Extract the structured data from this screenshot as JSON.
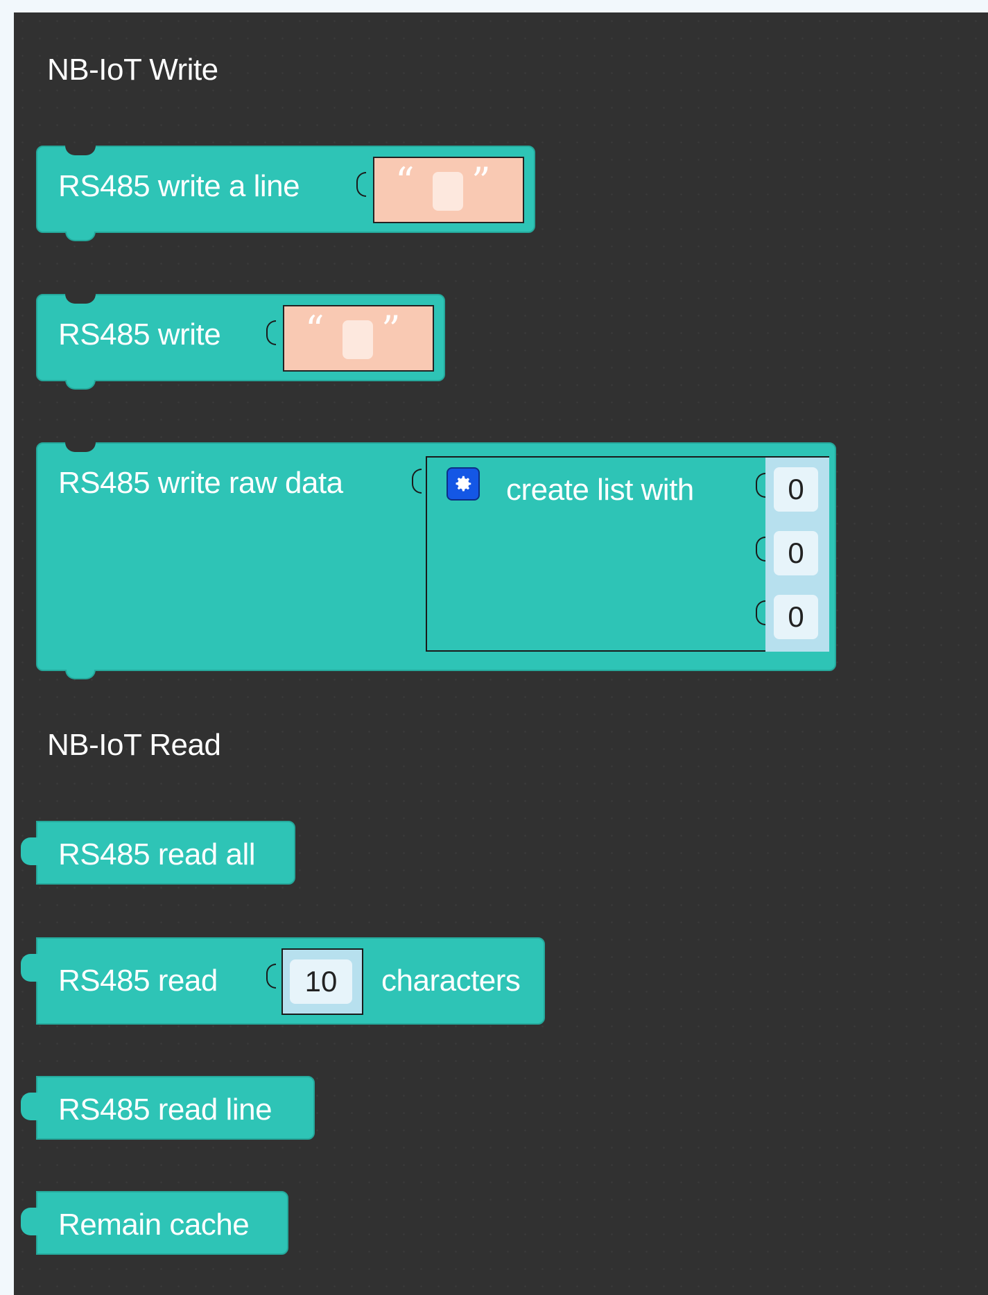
{
  "categories": {
    "write": "NB-IoT Write",
    "read": "NB-IoT Read"
  },
  "blocks": {
    "write_line": {
      "label": "RS485 write a line",
      "quote_open": "“",
      "quote_close": "”",
      "value": ""
    },
    "write": {
      "label": "RS485 write",
      "quote_open": "“",
      "quote_close": "”",
      "value": ""
    },
    "write_raw": {
      "label": "RS485 write raw data",
      "list_label": "create list with",
      "items": [
        "0",
        "0",
        "0"
      ]
    },
    "read_all": {
      "label": "RS485 read all"
    },
    "read_chars": {
      "label": "RS485 read",
      "count": "10",
      "suffix": "characters"
    },
    "read_line": {
      "label": "RS485 read line"
    },
    "remain_cache": {
      "label": "Remain cache"
    }
  },
  "colors": {
    "workspace": "#313131",
    "block": "#2ec4b6",
    "text_input": "#f9c9b3",
    "number_input": "#b7e0ee",
    "mutator": "#1457e5"
  },
  "icons": {
    "mutator": "gear-icon"
  }
}
